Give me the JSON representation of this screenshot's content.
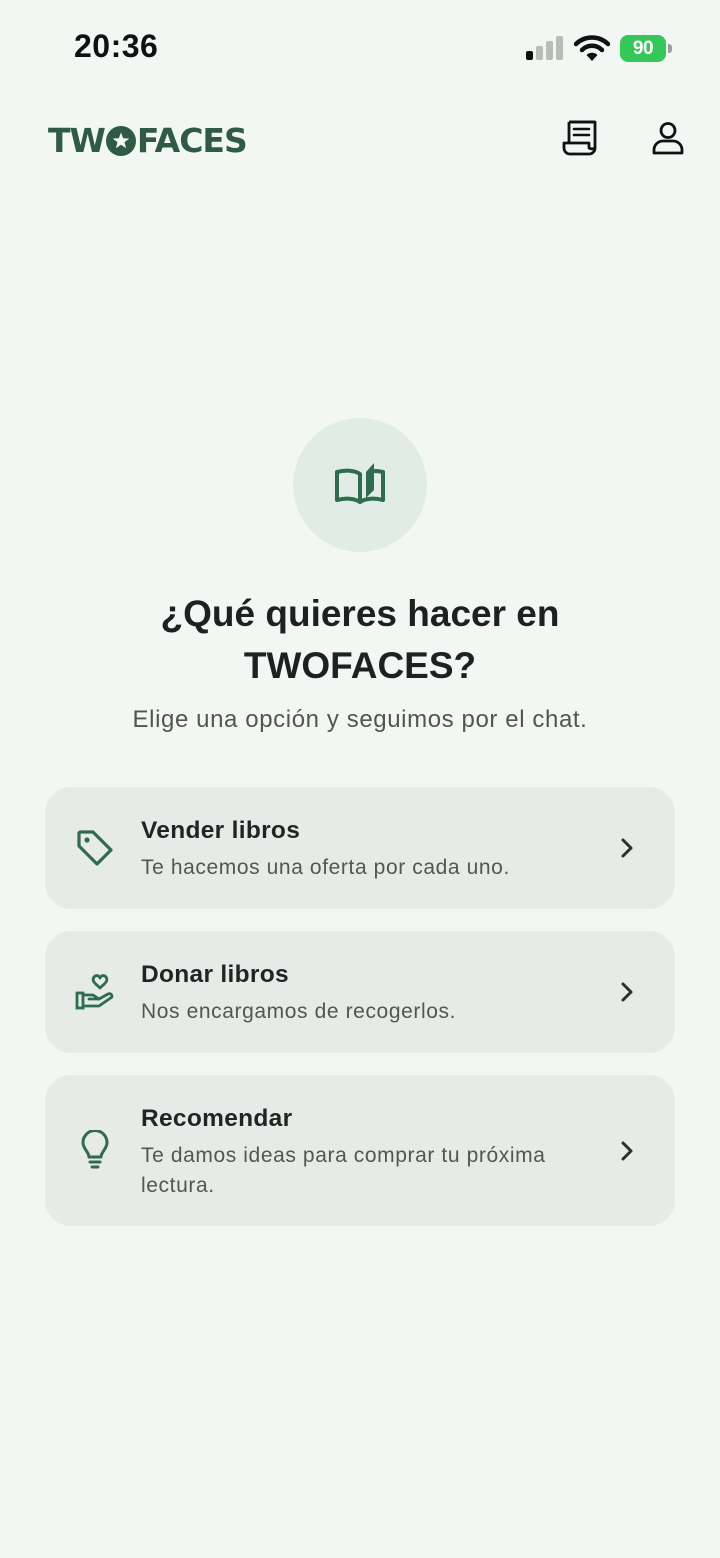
{
  "status_bar": {
    "time": "20:36",
    "battery_level": "90"
  },
  "header": {
    "logo_text_left": "TW",
    "logo_text_right": "FACES",
    "brand_color": "#2f5a44",
    "icons": [
      "receipt-icon",
      "user-icon"
    ]
  },
  "hero": {
    "icon": "book-open-icon",
    "title": "¿Qué quieres hacer en TWOFACES?",
    "subtitle": "Elige una opción y seguimos por el chat."
  },
  "options": [
    {
      "icon": "tag-icon",
      "title": "Vender libros",
      "description": "Te hacemos una oferta por cada uno."
    },
    {
      "icon": "hand-heart-icon",
      "title": "Donar libros",
      "description": "Nos encargamos de recogerlos."
    },
    {
      "icon": "lightbulb-icon",
      "title": "Recomendar",
      "description": "Te damos ideas para comprar tu próxima lectura."
    }
  ],
  "colors": {
    "background": "#f3f7f4",
    "accent": "#2f6b4c",
    "card": "#e6ebe8",
    "hero_circle": "#e0ece5"
  }
}
